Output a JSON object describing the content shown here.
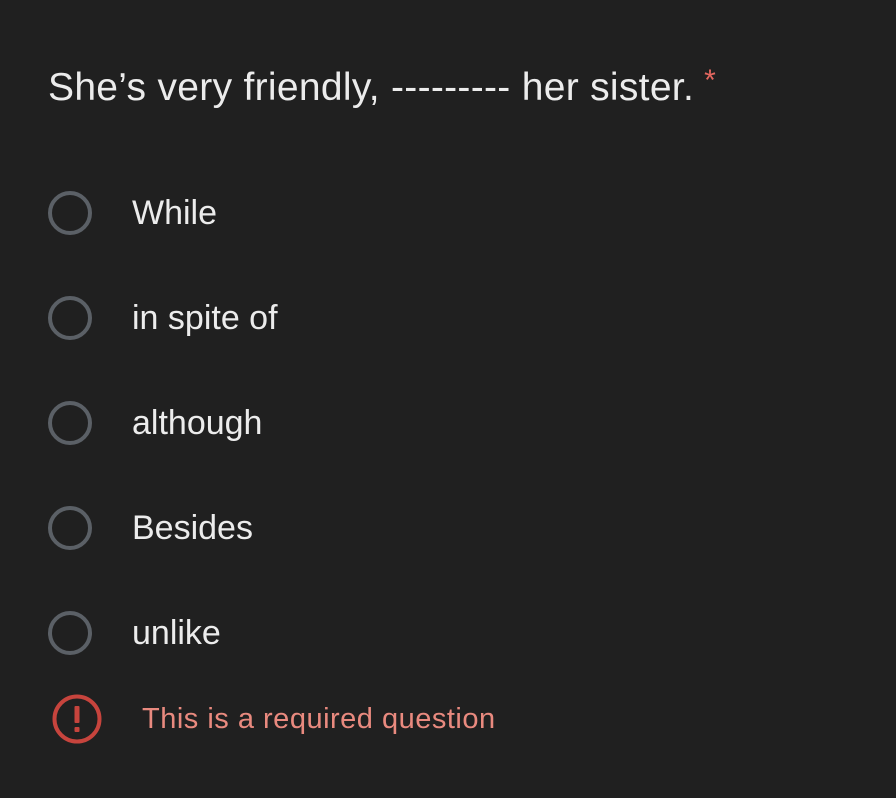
{
  "question": {
    "text": "She’s very friendly, --------- her sister.",
    "required_marker": "*"
  },
  "options": [
    {
      "label": "While"
    },
    {
      "label": "in spite of"
    },
    {
      "label": "although"
    },
    {
      "label": "Besides"
    },
    {
      "label": "unlike"
    }
  ],
  "error": {
    "icon": "error-icon",
    "message": "This is a required question"
  },
  "colors": {
    "background": "#202020",
    "text": "#ececec",
    "radio_border": "#5b6066",
    "required_star": "#e4675f",
    "error": "#e98a7f",
    "error_icon": "#c7443d"
  }
}
